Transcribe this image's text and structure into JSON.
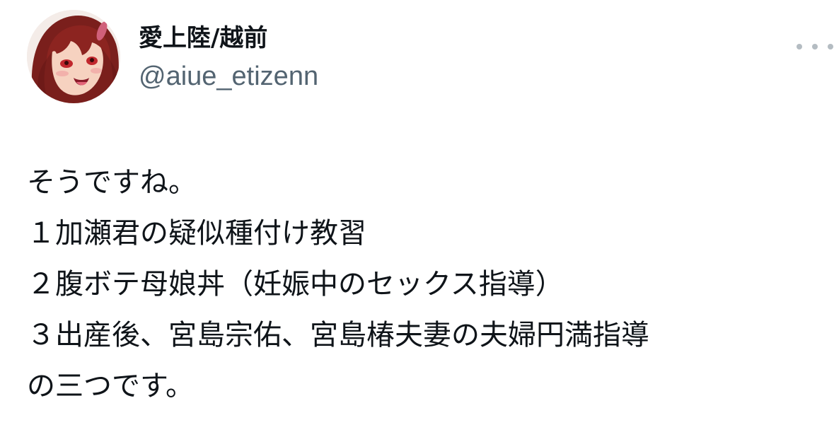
{
  "author": {
    "display_name": "愛上陸/越前",
    "handle": "@aiue_etizenn",
    "avatar_icon": "avatar-image"
  },
  "more_icon": "more-horizontal-icon",
  "tweet": {
    "lines": [
      "そうですね。",
      "１加瀬君の疑似種付け教習",
      "２腹ボテ母娘丼（妊娠中のセックス指導）",
      "３出産後、宮島宗佑、宮島椿夫妻の夫婦円満指導",
      "の三つです。"
    ]
  },
  "colors": {
    "text": "#0f1419",
    "secondary_text": "#536471",
    "dots": "#b4bcc2",
    "background": "#ffffff"
  }
}
